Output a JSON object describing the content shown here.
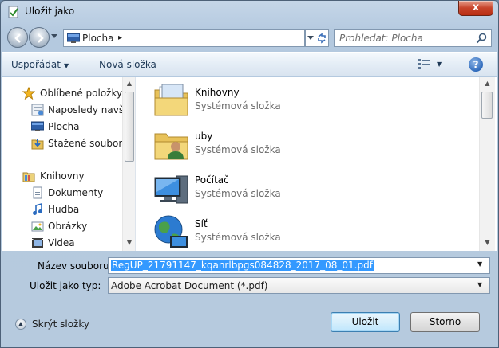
{
  "window": {
    "title": "Uložit jako",
    "close_label": "x"
  },
  "address_bar": {
    "location": "Plocha",
    "separator": "▸"
  },
  "search": {
    "placeholder": "Prohledat: Plocha"
  },
  "toolbar": {
    "organize_label": "Uspořádat",
    "new_folder_label": "Nová složka",
    "help_label": "?"
  },
  "nav_pane": {
    "favorites": {
      "label": "Oblíbené položky",
      "items": [
        {
          "label": "Naposledy navštívená místa",
          "icon": "recent-places-icon"
        },
        {
          "label": "Plocha",
          "icon": "desktop-icon"
        },
        {
          "label": "Stažené soubory",
          "icon": "downloads-icon"
        }
      ]
    },
    "libraries": {
      "label": "Knihovny",
      "items": [
        {
          "label": "Dokumenty",
          "icon": "documents-icon"
        },
        {
          "label": "Hudba",
          "icon": "music-icon"
        },
        {
          "label": "Obrázky",
          "icon": "pictures-icon"
        },
        {
          "label": "Videa",
          "icon": "videos-icon"
        }
      ]
    }
  },
  "files": [
    {
      "name": "Knihovny",
      "type": "Systémová složka",
      "icon": "libraries-folder-icon"
    },
    {
      "name": "uby",
      "type": "Systémová složka",
      "icon": "user-folder-icon"
    },
    {
      "name": "Počítač",
      "type": "Systémová složka",
      "icon": "computer-icon"
    },
    {
      "name": "Síť",
      "type": "Systémová složka",
      "icon": "network-icon"
    }
  ],
  "form": {
    "filename_label": "Název souboru:",
    "filename_value": "RegUP_21791147_kqanrlbpgs084828_2017_08_01.pdf",
    "filetype_label": "Uložit jako typ:",
    "filetype_value": "Adobe Acrobat Document (*.pdf)"
  },
  "footer": {
    "hide_folders_label": "Skrýt složky",
    "save_label": "Uložit",
    "cancel_label": "Storno"
  },
  "colors": {
    "accent": "#3399ff",
    "window_frame": "#b6cade",
    "title_close": "#c7432a"
  }
}
